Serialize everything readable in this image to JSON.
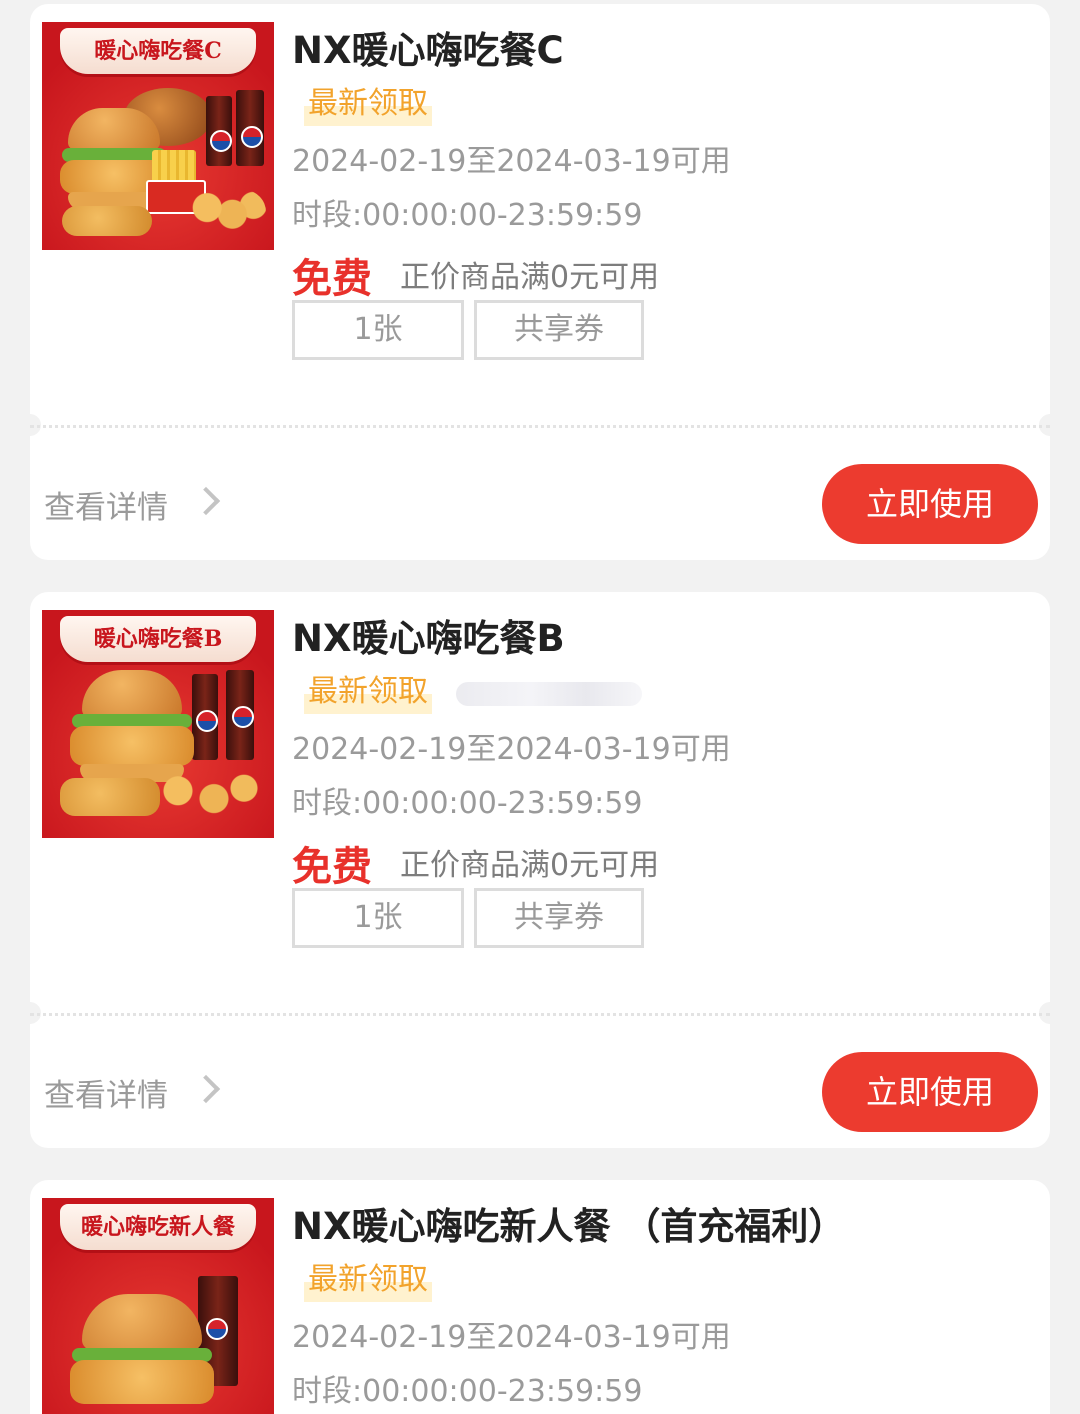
{
  "colors": {
    "accent_red": "#ec3b2f",
    "price_red": "#e8312b",
    "tag_orange": "#f2a32c",
    "tag_highlight": "#fff2cf",
    "text_dark": "#222222",
    "text_gray": "#9a9a9a",
    "background": "#f2f2f2",
    "card": "#ffffff",
    "image_red": "#c8161d"
  },
  "icons": {
    "details_chevron": "chevron-right-icon"
  },
  "coupons": [
    {
      "image_banner": "暖心嗨吃餐C",
      "title": "NX暖心嗨吃餐C",
      "tag": "最新领取",
      "validity": "2024-02-19至2024-03-19可用",
      "period": "时段:00:00:00-23:59:59",
      "price": "免费",
      "condition": "正价商品满0元可用",
      "count_chip": "1张",
      "type_chip": "共享券",
      "details_label": "查看详情",
      "action_label": "立即使用"
    },
    {
      "image_banner": "暖心嗨吃餐B",
      "title": "NX暖心嗨吃餐B",
      "tag": "最新领取",
      "validity": "2024-02-19至2024-03-19可用",
      "period": "时段:00:00:00-23:59:59",
      "price": "免费",
      "condition": "正价商品满0元可用",
      "count_chip": "1张",
      "type_chip": "共享券",
      "details_label": "查看详情",
      "action_label": "立即使用"
    },
    {
      "image_banner": "暖心嗨吃新人餐",
      "title": "NX暖心嗨吃新人餐 （首充福利）",
      "tag": "最新领取",
      "validity": "2024-02-19至2024-03-19可用",
      "period": "时段:00:00:00-23:59:59"
    }
  ]
}
